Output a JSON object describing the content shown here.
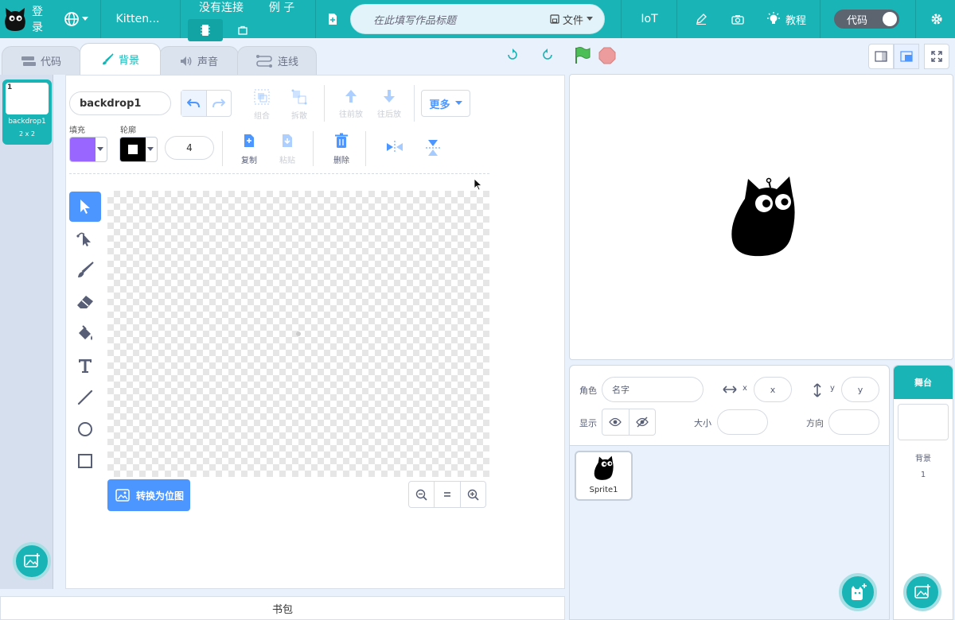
{
  "menubar": {
    "login": "登录",
    "project_name": "Kitten...",
    "connection": "没有连接",
    "examples": "例 子",
    "title_placeholder": "在此填写作品标题",
    "file_menu": "文件",
    "iot": "IoT",
    "tutorial": "教程",
    "code_toggle": "代码"
  },
  "tabs": [
    {
      "label": "代码",
      "icon": "code-blocks-icon"
    },
    {
      "label": "背景",
      "icon": "brush-icon",
      "active": true
    },
    {
      "label": "声音",
      "icon": "speaker-icon"
    },
    {
      "label": "连线",
      "icon": "wiring-icon"
    }
  ],
  "costumes": [
    {
      "number": "1",
      "name": "backdrop1",
      "size": "2 x 2"
    }
  ],
  "paint_editor": {
    "costume_name": "backdrop1",
    "group_label": "组合",
    "ungroup_label": "拆散",
    "forward_label": "往前放",
    "backward_label": "往后放",
    "more_label": "更多",
    "fill_label": "填充",
    "outline_label": "轮廓",
    "outline_width": "4",
    "copy_label": "复制",
    "paste_label": "粘贴",
    "delete_label": "删除",
    "convert_label": "转换为位图",
    "fill_color": "#9966ff",
    "outline_color": "#000000"
  },
  "backpack_label": "书包",
  "sprite_info": {
    "sprite_label": "角色",
    "name_placeholder": "名字",
    "x_label": "x",
    "x_placeholder": "x",
    "y_label": "y",
    "y_placeholder": "y",
    "show_label": "显示",
    "size_label": "大小",
    "direction_label": "方向"
  },
  "sprites": [
    {
      "name": "Sprite1"
    }
  ],
  "stage_panel": {
    "title": "舞台",
    "backdrops_label": "背景",
    "backdrop_count": "1"
  },
  "colors": {
    "brand": "#18b4b6",
    "accent_blue": "#4c97ff",
    "stop_red": "#ec9c9c",
    "flag_green": "#4cbf56"
  }
}
